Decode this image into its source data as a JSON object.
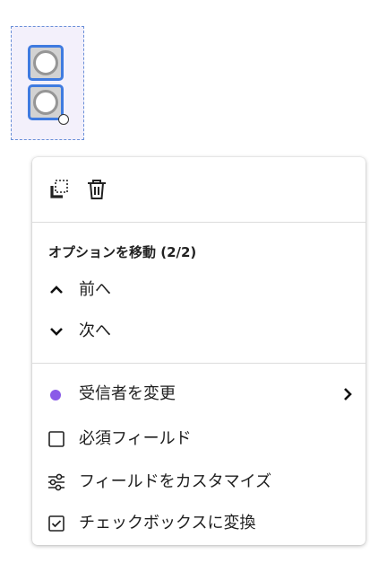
{
  "menu": {
    "toolbar": {
      "duplicate_icon": "duplicate-icon",
      "delete_icon": "trash-icon"
    },
    "section_title": "オプションを移動 (2/2)",
    "previous_label": "前へ",
    "next_label": "次へ",
    "change_recipient_label": "受信者を変更",
    "recipient_color": "#8a5be8",
    "required_field_label": "必須フィールド",
    "required_checked": false,
    "customize_field_label": "フィールドをカスタマイズ",
    "convert_checkbox_label": "チェックボックスに変換"
  },
  "colors": {
    "selection_blue": "#3f7be0",
    "group_bg": "#f3f0fb",
    "recipient_purple": "#8a5be8"
  }
}
